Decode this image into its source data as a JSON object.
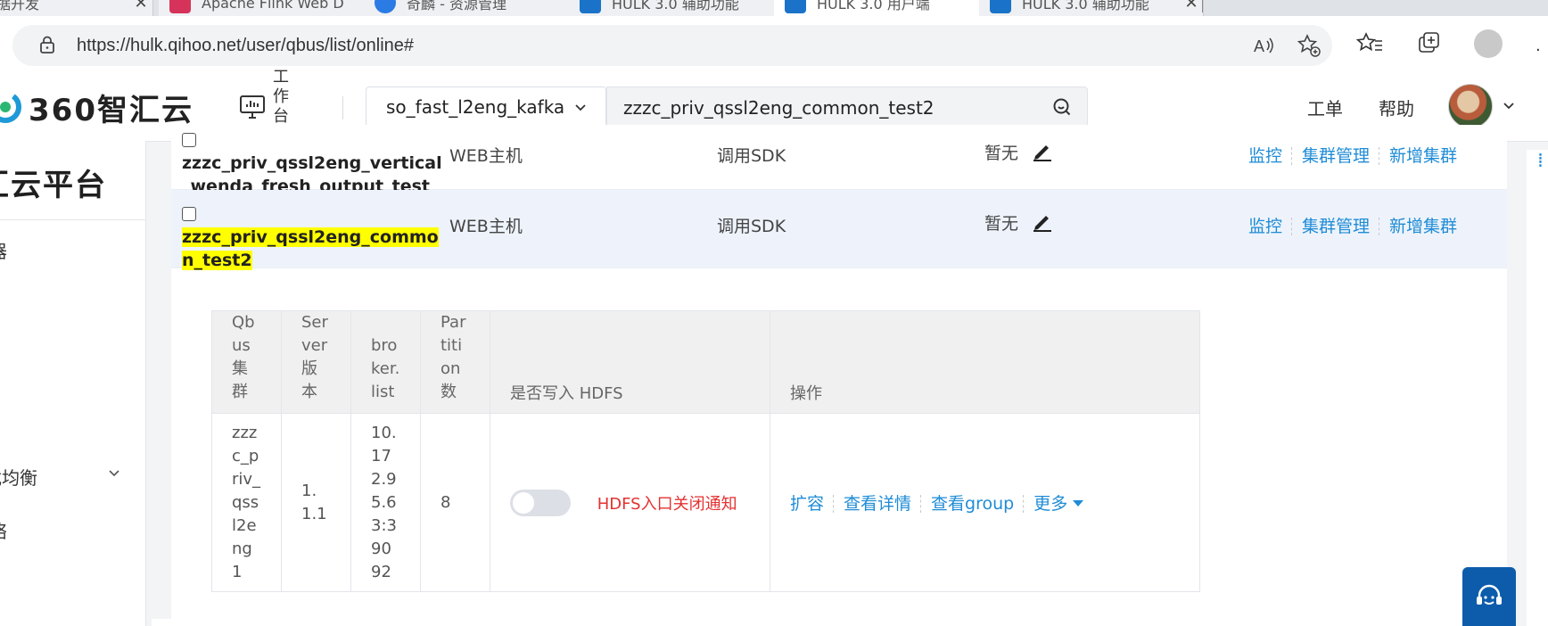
{
  "browser": {
    "tabs": [
      {
        "title": "奇麟 - 数据开发",
        "favicon_color": "#2a7be4"
      },
      {
        "title": "Apache Flink Web D",
        "favicon_color": "#d6335a"
      },
      {
        "title": "奇麟 - 资源管理",
        "favicon_color": "#2a7be4"
      },
      {
        "title": "HULK 3.0 辅助功能",
        "favicon_color": "#1a73c8"
      },
      {
        "title": "HULK 3.0 用户端",
        "favicon_color": "#1a73c8"
      },
      {
        "title": "HULK 3.0 辅助功能",
        "favicon_color": "#1a73c8"
      }
    ],
    "url": "https://hulk.qihoo.net/user/qbus/list/online#"
  },
  "header": {
    "logo_text": "360智汇云",
    "work_label": "工作台",
    "cluster_select": "so_fast_l2eng_kafka",
    "search_value": "zzzc_priv_qssl2eng_common_test2",
    "links": [
      "工单",
      "帮助"
    ]
  },
  "sidebar": {
    "title": "汇云平台",
    "items": [
      "器",
      "载均衡",
      "络"
    ]
  },
  "topics": [
    {
      "name_line1": "zzzc_priv_qssl2eng_vertical",
      "name_line2": "_wenda_fresh_output_test",
      "host": "WEB主机",
      "access": "调用SDK",
      "remark": "暂无",
      "ops": [
        "监控",
        "集群管理",
        "新增集群"
      ]
    },
    {
      "name_line1": "zzzc_priv_qssl2eng_commo",
      "name_line2": "n_test2",
      "host": "WEB主机",
      "access": "调用SDK",
      "remark": "暂无",
      "ops": [
        "监控",
        "集群管理",
        "新增集群"
      ]
    }
  ],
  "inner_table": {
    "headers": [
      "Qbus集群",
      "Server版本",
      "broker.list",
      "Partition数",
      "是否写入 HDFS",
      "操作"
    ],
    "row": {
      "cluster": "zzzc_priv_qssl2eng1",
      "version": "1.1.1",
      "broker": "10.172.95.63:39092",
      "partitions": "8",
      "hdfs_note": "HDFS入口关闭通知",
      "hdfs_enabled": false,
      "ops": [
        "扩容",
        "查看详情",
        "查看group",
        "更多"
      ]
    }
  }
}
